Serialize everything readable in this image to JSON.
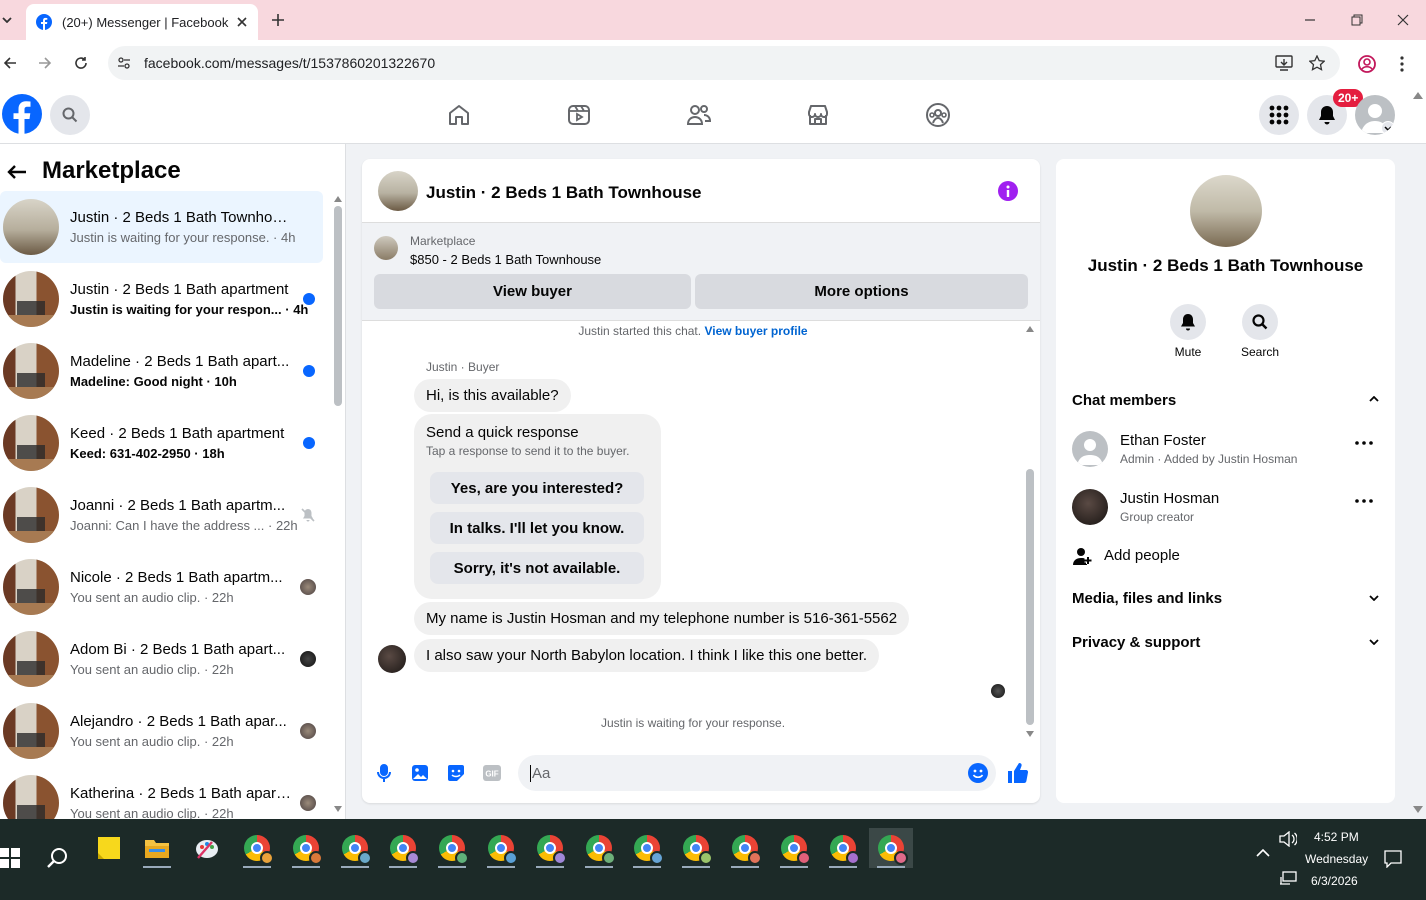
{
  "browser": {
    "tab_title": "(20+) Messenger | Facebook",
    "url": "facebook.com/messages/t/1537860201322670"
  },
  "fb_header": {
    "notifications_badge": "20+"
  },
  "sidebar": {
    "title": "Marketplace",
    "conversations": [
      {
        "name": "Justin · 2 Beds 1 Bath Townhouse",
        "preview": "Justin is waiting for your response. · 4h",
        "bold": false,
        "active": true
      },
      {
        "name": "Justin · 2 Beds 1 Bath apartment",
        "preview": "Justin is waiting for your respon... · 4h",
        "bold": true,
        "status": "unread"
      },
      {
        "name": "Madeline · 2 Beds 1 Bath apart...",
        "preview": "Madeline: Good night · 10h",
        "bold": true,
        "status": "unread"
      },
      {
        "name": "Keed · 2 Beds 1 Bath apartment",
        "preview": "Keed: 631-402-2950 · 18h",
        "bold": true,
        "status": "unread"
      },
      {
        "name": "Joanni · 2 Beds 1 Bath apartm...",
        "preview": "Joanni: Can I have the address ... · 22h",
        "bold": false,
        "status": "muted"
      },
      {
        "name": "Nicole · 2 Beds 1 Bath apartm...",
        "preview": "You sent an audio clip. · 22h",
        "bold": false,
        "status": "seen"
      },
      {
        "name": "Adom Bi · 2 Beds 1 Bath apart...",
        "preview": "You sent an audio clip. · 22h",
        "bold": false,
        "status": "seen"
      },
      {
        "name": "Alejandro · 2 Beds 1 Bath apar...",
        "preview": "You sent an audio clip. · 22h",
        "bold": false,
        "status": "seen"
      },
      {
        "name": "Katherina · 2 Beds 1 Bath apartm...",
        "preview": "You sent an audio clip. · 22h",
        "bold": false,
        "status": "seen"
      }
    ]
  },
  "chat": {
    "title": "Justin · 2 Beds 1 Bath Townhouse",
    "listing_source": "Marketplace",
    "listing_title": "$850 - 2 Beds 1 Bath Townhouse",
    "view_buyer_label": "View buyer",
    "more_options_label": "More options",
    "started_text": "Justin started this chat.",
    "view_profile_link": "View buyer profile",
    "sender_label": "Justin · Buyer",
    "messages": [
      "Hi, is this available?",
      "My name is Justin Hosman and my telephone number is 516-361-5562",
      "I also saw your North Babylon location. I think I like this one better."
    ],
    "quick_response": {
      "title": "Send a quick response",
      "subtitle": "Tap a response to send it to the buyer.",
      "options": [
        "Yes, are you interested?",
        "In talks. I'll let you know.",
        "Sorry, it's not available."
      ]
    },
    "waiting_text": "Justin is waiting for your response.",
    "composer_placeholder": "Aa"
  },
  "info_panel": {
    "title": "Justin · 2 Beds 1 Bath Townhouse",
    "mute_label": "Mute",
    "search_label": "Search",
    "chat_members_label": "Chat members",
    "members": [
      {
        "name": "Ethan Foster",
        "role": "Admin · Added by Justin Hosman"
      },
      {
        "name": "Justin Hosman",
        "role": "Group creator"
      }
    ],
    "add_people_label": "Add people",
    "media_label": "Media, files and links",
    "privacy_label": "Privacy & support"
  },
  "taskbar": {
    "time": "4:52 PM",
    "day": "Wednesday",
    "date": "6/3/2026"
  },
  "colors": {
    "fb_blue": "#0866ff",
    "info_purple": "#a020f0",
    "notification_red": "#e41e3f",
    "chrome_tab_bg": "#f8d8de"
  }
}
